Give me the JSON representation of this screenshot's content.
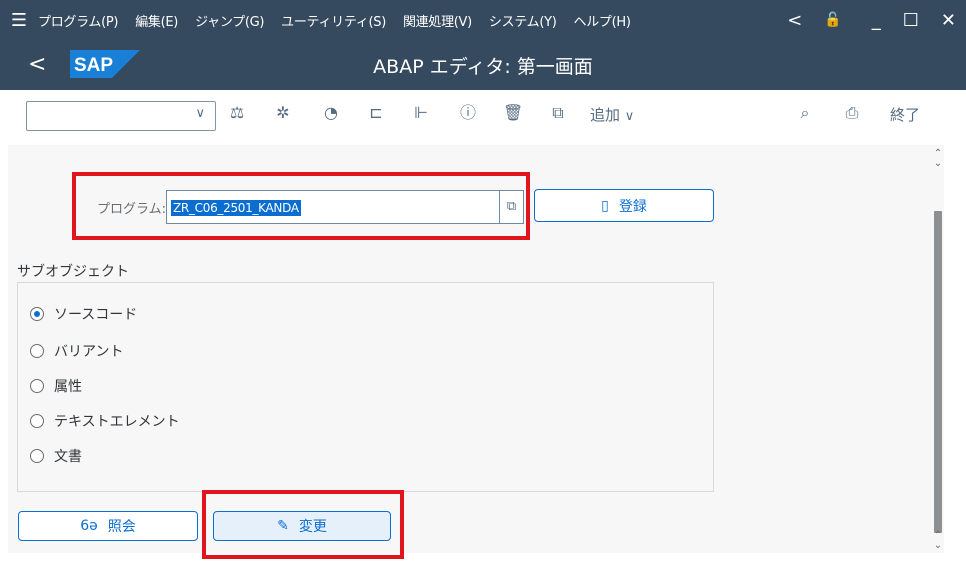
{
  "menubar": {
    "items": [
      "プログラム(P)",
      "編集(E)",
      "ジャンプ(G)",
      "ユーティリティ(S)",
      "関連処理(V)",
      "システム(Y)",
      "ヘルプ(H)"
    ],
    "controls": {
      "back": "<",
      "lock": "🔓",
      "minimize": "_",
      "maximize": "☐",
      "close": "✕"
    }
  },
  "title": {
    "back": "<",
    "logo": "SAP",
    "text": "ABAP エディタ: 第一画面"
  },
  "toolbar": {
    "select_value": "",
    "icons": [
      "balance-icon",
      "wand-icon",
      "clock-icon",
      "object-list-icon",
      "hierarchy-icon",
      "info-icon",
      "trash-icon",
      "copy-icon"
    ],
    "add_label": "追加",
    "exit_label": "終了"
  },
  "program": {
    "label": "プログラム:",
    "value": "ZR_C06_2501_KANDA",
    "register_label": "登録"
  },
  "subobjects": {
    "label": "サブオブジェクト",
    "options": [
      "ソースコード",
      "バリアント",
      "属性",
      "テキストエレメント",
      "文書"
    ],
    "selected": "ソースコード"
  },
  "actions": {
    "display_label": "照会",
    "change_label": "変更"
  },
  "colors": {
    "shell": "#354a5f",
    "accent": "#0a6ed1",
    "highlight": "#e0151d",
    "background": "#f7f7f7"
  }
}
